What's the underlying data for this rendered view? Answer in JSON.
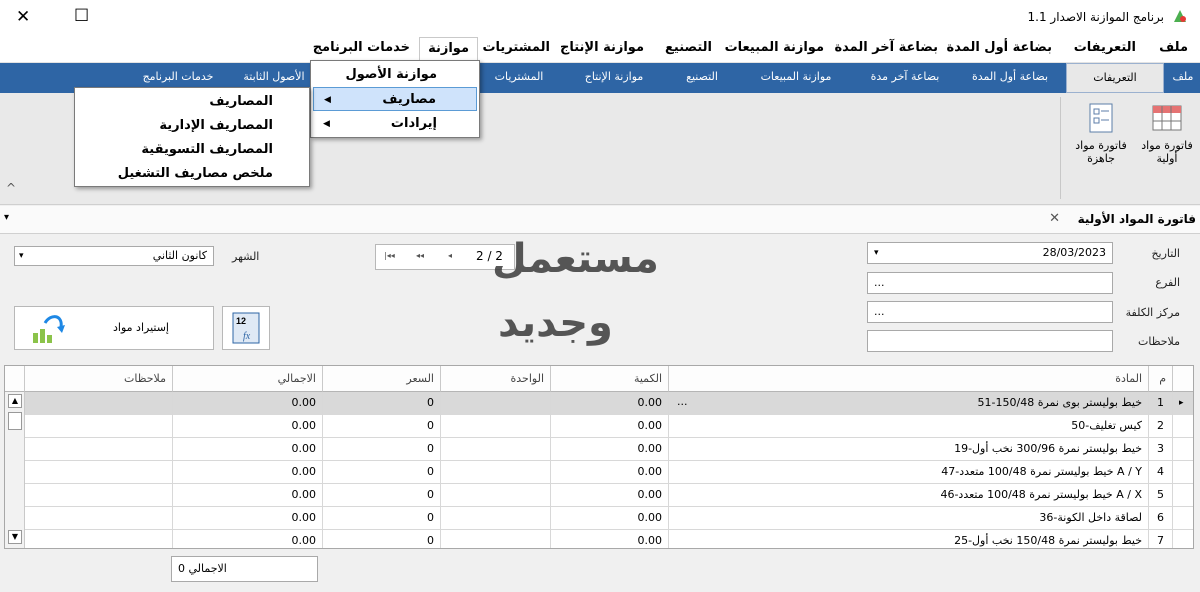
{
  "window": {
    "title": "برنامج الموازنة الاصدار 1.1",
    "close_glyph": "✕",
    "maximize_glyph": "☐"
  },
  "menubar": {
    "items": [
      {
        "label": "ملف"
      },
      {
        "label": "التعريفات"
      },
      {
        "label": "بضاعة أول المدة"
      },
      {
        "label": "بضاعة آخر المدة"
      },
      {
        "label": "موازنة المبيعات"
      },
      {
        "label": "التصنيع"
      },
      {
        "label": "موازنة الإنتاج"
      },
      {
        "label": "المشتريات"
      },
      {
        "label": "موازنة"
      },
      {
        "label": "خدمات البرنامج"
      }
    ]
  },
  "ribbon_tabs": {
    "items": [
      {
        "label": "ملف"
      },
      {
        "label": "التعريفات"
      },
      {
        "label": "بضاعة أول المدة"
      },
      {
        "label": "بضاعة آخر مدة"
      },
      {
        "label": "موازنة المبيعات"
      },
      {
        "label": "التصنيع"
      },
      {
        "label": "موازنة الإنتاج"
      },
      {
        "label": "المشتريات"
      },
      {
        "label": "الأصول الثابتة"
      },
      {
        "label": "خدمات البرنامج"
      }
    ]
  },
  "ribbon": {
    "btn_raw_invoice": "فاتورة مواد أولية",
    "btn_ready_invoice": "فاتورة مواد جاهزة",
    "collapse_glyph": "^"
  },
  "dropdown_main": {
    "items": [
      {
        "label": "موازنة الأصول"
      },
      {
        "label": "مصاريف"
      },
      {
        "label": "إيرادات"
      }
    ]
  },
  "dropdown_sub": {
    "items": [
      {
        "label": "المصاريف"
      },
      {
        "label": "المصاريف الإدارية"
      },
      {
        "label": "المصاريف التسويقية"
      },
      {
        "label": "ملخص مصاريف التشغيل"
      }
    ]
  },
  "doc_tab": {
    "title": "فاتورة المواد الأولية",
    "close_glyph": "✕",
    "pin_glyph": "▾"
  },
  "form": {
    "date_label": "التاريخ",
    "date_value": "28/03/2023",
    "branch_label": "الفرع",
    "branch_value": "...",
    "cost_center_label": "مركز الكلفة",
    "cost_center_value": "...",
    "notes_label": "ملاحظات",
    "notes_value": "",
    "month_label": "الشهر",
    "month_value": "كانون الثاني",
    "pager_text": "2 / 2",
    "import_button": "إستيراد مواد",
    "calc_button_label": "12 fx"
  },
  "watermark": {
    "line1": "مستعمل",
    "line2": "وجديد"
  },
  "grid": {
    "headers": {
      "index": "م",
      "material": "المادة",
      "qty": "الكمية",
      "unit": "الواحدة",
      "price": "السعر",
      "total": "الاجمالي",
      "notes": "ملاحظات"
    },
    "rows": [
      {
        "index": "1",
        "material": "51-خيط بوليستر بوى نمرة 150/48",
        "qty": "0.00",
        "unit": "",
        "price": "0",
        "total": "0.00",
        "notes": "",
        "ellipsis": "..."
      },
      {
        "index": "2",
        "material": "50-كيس تغليف",
        "qty": "0.00",
        "unit": "",
        "price": "0",
        "total": "0.00",
        "notes": "",
        "ellipsis": ""
      },
      {
        "index": "3",
        "material": "19-خيط بوليستر نمرة 300/96 نخب أول",
        "qty": "0.00",
        "unit": "",
        "price": "0",
        "total": "0.00",
        "notes": "",
        "ellipsis": ""
      },
      {
        "index": "4",
        "material": "47-خيط بوليستر نمرة 100/48 متعدد A / Y",
        "qty": "0.00",
        "unit": "",
        "price": "0",
        "total": "0.00",
        "notes": "",
        "ellipsis": ""
      },
      {
        "index": "5",
        "material": "46-خيط بوليستر نمرة 100/48 متعدد A / X",
        "qty": "0.00",
        "unit": "",
        "price": "0",
        "total": "0.00",
        "notes": "",
        "ellipsis": ""
      },
      {
        "index": "6",
        "material": "36-لصاقة داخل الكونة",
        "qty": "0.00",
        "unit": "",
        "price": "0",
        "total": "0.00",
        "notes": "",
        "ellipsis": ""
      },
      {
        "index": "7",
        "material": "25-خيط بوليستر نمرة 150/48 نخب أول",
        "qty": "0.00",
        "unit": "",
        "price": "0",
        "total": "0.00",
        "notes": "",
        "ellipsis": ""
      }
    ],
    "row_pointer_glyph": "▸"
  },
  "footer": {
    "total_label": "الاجمالي 0"
  },
  "colors": {
    "ribbon_blue": "#2e65a5",
    "highlight": "#cfe3fb"
  }
}
